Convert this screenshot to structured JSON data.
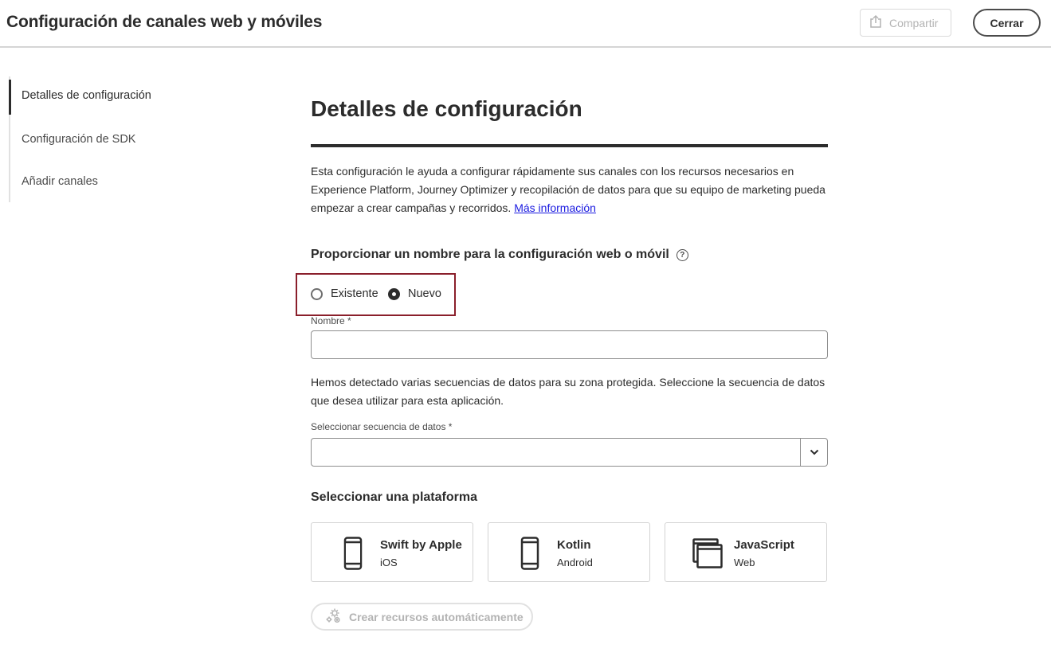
{
  "header": {
    "title": "Configuración de canales web y móviles",
    "share_label": "Compartir",
    "close_label": "Cerrar"
  },
  "sidebar": {
    "items": [
      {
        "label": "Detalles de configuración",
        "active": true
      },
      {
        "label": "Configuración de SDK",
        "active": false
      },
      {
        "label": "Añadir canales",
        "active": false
      }
    ]
  },
  "main": {
    "title": "Detalles de configuración",
    "description": "Esta configuración le ayuda a configurar rápidamente sus canales con los recursos necesarios en Experience Platform, Journey Optimizer y recopilación de datos para que su equipo de marketing pueda empezar a crear campañas y recorridos.",
    "more_info_link": "Más información",
    "name_section": {
      "heading": "Proporcionar un nombre para la configuración web o móvil",
      "radio_options": [
        {
          "label": "Existente",
          "checked": false
        },
        {
          "label": "Nuevo",
          "checked": true
        }
      ],
      "name_label": "Nombre",
      "required_mark": "*",
      "name_value": ""
    },
    "datastream": {
      "hint": "Hemos detectado varias secuencias de datos para su zona protegida. Seleccione la secuencia de datos que desea utilizar para esta aplicación.",
      "label": "Seleccionar secuencia de datos",
      "required_mark": "*",
      "selected_value": ""
    },
    "platform_section": {
      "heading": "Seleccionar una plataforma",
      "cards": [
        {
          "title": "Swift by Apple",
          "subtitle": "iOS",
          "icon": "phone-icon"
        },
        {
          "title": "Kotlin",
          "subtitle": "Android",
          "icon": "phone-icon"
        },
        {
          "title": "JavaScript",
          "subtitle": "Web",
          "icon": "browser-windows-icon"
        }
      ]
    },
    "auto_create_label": "Crear recursos automáticamente"
  },
  "colors": {
    "highlight_border": "#8a1f2b",
    "link": "#1a1ae0",
    "text": "#2c2c2c",
    "disabled": "#b3b3b3"
  }
}
